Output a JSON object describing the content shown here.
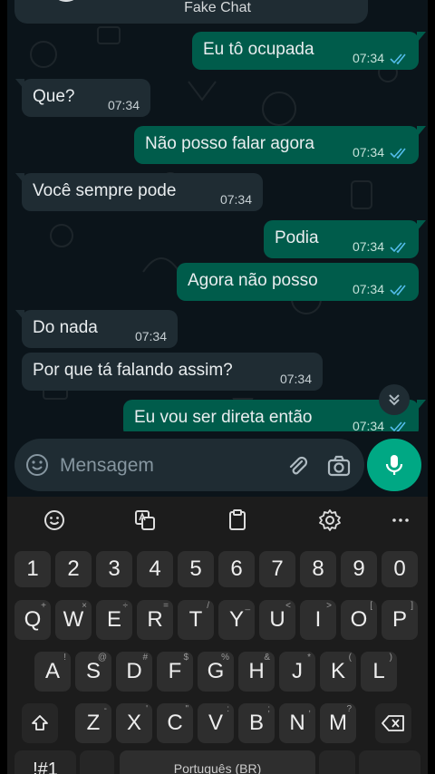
{
  "header": {
    "title": "Fake Chat"
  },
  "messages": [
    {
      "dir": "out",
      "text": "Eu tô ocupada",
      "time": "07:34"
    },
    {
      "dir": "in",
      "text": "Que?",
      "time": "07:34"
    },
    {
      "dir": "out",
      "text": "Não posso falar agora",
      "time": "07:34"
    },
    {
      "dir": "in",
      "text": "Você sempre pode",
      "time": "07:34"
    },
    {
      "dir": "out",
      "text": "Podia",
      "time": "07:34"
    },
    {
      "dir": "out",
      "text": "Agora não posso",
      "time": "07:34"
    },
    {
      "dir": "in",
      "text": "Do nada",
      "time": "07:34"
    },
    {
      "dir": "in",
      "text": "Por que tá falando assim?",
      "time": "07:34"
    },
    {
      "dir": "out",
      "text": "Eu vou ser direta então",
      "time": "07:34"
    }
  ],
  "composer": {
    "placeholder": "Mensagem"
  },
  "keyboard": {
    "numbers": [
      "1",
      "2",
      "3",
      "4",
      "5",
      "6",
      "7",
      "8",
      "9",
      "0"
    ],
    "row1": [
      [
        "Q",
        "+"
      ],
      [
        "W",
        "×"
      ],
      [
        "E",
        "÷"
      ],
      [
        "R",
        "="
      ],
      [
        "T",
        "/"
      ],
      [
        "Y",
        "_"
      ],
      [
        "U",
        "<"
      ],
      [
        "I",
        ">"
      ],
      [
        "O",
        "["
      ],
      [
        "P",
        "]"
      ]
    ],
    "row2": [
      [
        "A",
        "!"
      ],
      [
        "S",
        "@"
      ],
      [
        "D",
        "#"
      ],
      [
        "F",
        "$"
      ],
      [
        "G",
        "%"
      ],
      [
        "H",
        "&"
      ],
      [
        "J",
        "*"
      ],
      [
        "K",
        "("
      ],
      [
        "L",
        ")"
      ]
    ],
    "row3": [
      [
        "Z",
        "-"
      ],
      [
        "X",
        "'"
      ],
      [
        "C",
        "\""
      ],
      [
        "V",
        ":"
      ],
      [
        "B",
        ";"
      ],
      [
        "N",
        ","
      ],
      [
        "M",
        "?"
      ]
    ],
    "symbols_label": "!#1",
    "space_label": "Português (BR)"
  },
  "colors": {
    "chat_bg": "#0b141a",
    "incoming_bubble": "#1f2c33",
    "outgoing_bubble": "#005c4b",
    "accent": "#00a884",
    "read_ticks": "#53bdeb"
  }
}
